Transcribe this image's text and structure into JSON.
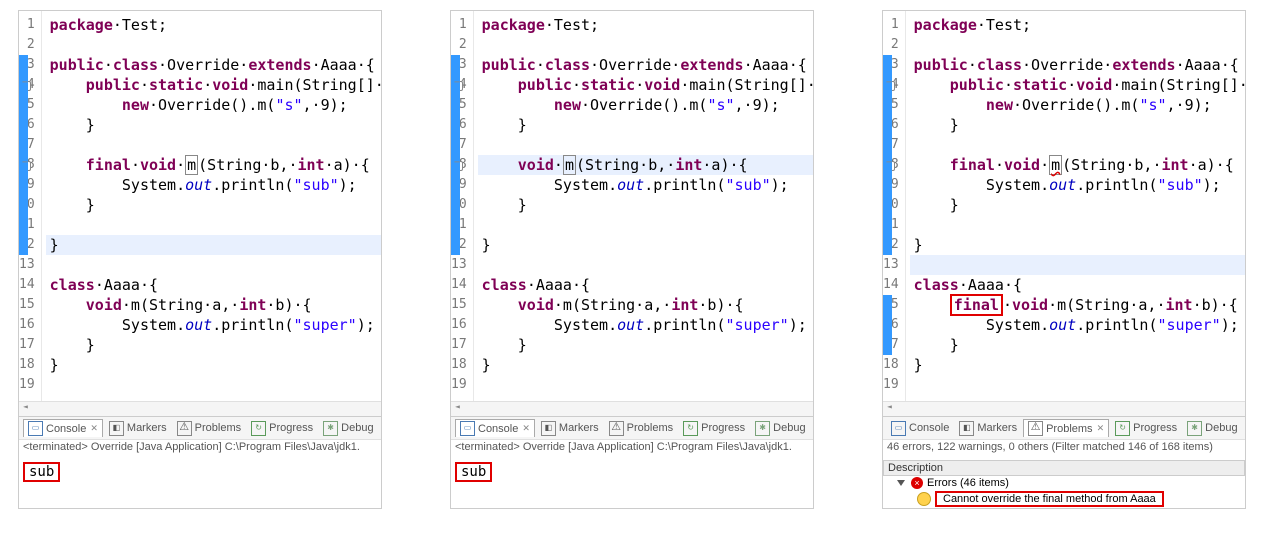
{
  "tabs": {
    "console": "Console",
    "markers": "Markers",
    "problems": "Problems",
    "progress": "Progress",
    "debug": "Debug"
  },
  "terminated": "<terminated> Override [Java Application] C:\\Program Files\\Java\\jdk1.",
  "console_out": "sub",
  "problems_summary": "46 errors, 122 warnings, 0 others (Filter matched 146 of 168 items)",
  "problems_header": "Description",
  "errors_group": "Errors (46 items)",
  "error_msg": "Cannot override the final method from Aaaa",
  "panes": [
    {
      "cursor": 12,
      "folds": [
        3,
        4,
        5,
        6,
        7,
        8,
        9,
        10,
        11,
        12
      ],
      "lines": [
        [
          {
            "t": "package",
            "c": "kw"
          },
          {
            "t": "·Test;"
          }
        ],
        [],
        [
          {
            "t": "public",
            "c": "kw"
          },
          {
            "t": "·"
          },
          {
            "t": "class",
            "c": "kw"
          },
          {
            "t": "·Override·"
          },
          {
            "t": "extends",
            "c": "kw"
          },
          {
            "t": "·Aaaa·{"
          }
        ],
        [
          {
            "t": "    "
          },
          {
            "t": "public",
            "c": "kw"
          },
          {
            "t": "·"
          },
          {
            "t": "static",
            "c": "kw"
          },
          {
            "t": "·"
          },
          {
            "t": "void",
            "c": "kw"
          },
          {
            "t": "·main(String[]·args)·{"
          }
        ],
        [
          {
            "t": "        "
          },
          {
            "t": "new",
            "c": "kw"
          },
          {
            "t": "·Override().m("
          },
          {
            "t": "\"s\"",
            "c": "str"
          },
          {
            "t": ",·9);"
          }
        ],
        [
          {
            "t": "    }"
          }
        ],
        [],
        [
          {
            "t": "    "
          },
          {
            "t": "final",
            "c": "kw"
          },
          {
            "t": "·"
          },
          {
            "t": "void",
            "c": "kw"
          },
          {
            "t": "·"
          },
          {
            "t": "m",
            "c": "box"
          },
          {
            "t": "(String·b,·"
          },
          {
            "t": "int",
            "c": "kw"
          },
          {
            "t": "·a)·{"
          }
        ],
        [
          {
            "t": "        System."
          },
          {
            "t": "out",
            "c": "fld"
          },
          {
            "t": ".println("
          },
          {
            "t": "\"sub\"",
            "c": "str"
          },
          {
            "t": ");"
          }
        ],
        [
          {
            "t": "    }"
          }
        ],
        [],
        [
          {
            "t": "}"
          }
        ],
        [],
        [
          {
            "t": "class",
            "c": "kw"
          },
          {
            "t": "·Aaaa·{"
          }
        ],
        [
          {
            "t": "    "
          },
          {
            "t": "void",
            "c": "kw"
          },
          {
            "t": "·m(String·a,·"
          },
          {
            "t": "int",
            "c": "kw"
          },
          {
            "t": "·b)·{"
          }
        ],
        [
          {
            "t": "        System."
          },
          {
            "t": "out",
            "c": "fld"
          },
          {
            "t": ".println("
          },
          {
            "t": "\"super\"",
            "c": "str"
          },
          {
            "t": ");"
          }
        ],
        [
          {
            "t": "    }"
          }
        ],
        [
          {
            "t": "}"
          }
        ],
        []
      ],
      "bottom": "console"
    },
    {
      "cursor": 8,
      "folds": [
        3,
        4,
        5,
        6,
        7,
        8,
        9,
        10,
        11,
        12
      ],
      "lines": [
        [
          {
            "t": "package",
            "c": "kw"
          },
          {
            "t": "·Test;"
          }
        ],
        [],
        [
          {
            "t": "public",
            "c": "kw"
          },
          {
            "t": "·"
          },
          {
            "t": "class",
            "c": "kw"
          },
          {
            "t": "·Override·"
          },
          {
            "t": "extends",
            "c": "kw"
          },
          {
            "t": "·Aaaa·{"
          }
        ],
        [
          {
            "t": "    "
          },
          {
            "t": "public",
            "c": "kw"
          },
          {
            "t": "·"
          },
          {
            "t": "static",
            "c": "kw"
          },
          {
            "t": "·"
          },
          {
            "t": "void",
            "c": "kw"
          },
          {
            "t": "·main(String[]·args)·{"
          }
        ],
        [
          {
            "t": "        "
          },
          {
            "t": "new",
            "c": "kw"
          },
          {
            "t": "·Override().m("
          },
          {
            "t": "\"s\"",
            "c": "str"
          },
          {
            "t": ",·9);"
          }
        ],
        [
          {
            "t": "    }"
          }
        ],
        [],
        [
          {
            "t": "    "
          },
          {
            "t": "void",
            "c": "kw"
          },
          {
            "t": "·"
          },
          {
            "t": "m",
            "c": "box"
          },
          {
            "t": "(String·b,·"
          },
          {
            "t": "int",
            "c": "kw"
          },
          {
            "t": "·a)·{"
          }
        ],
        [
          {
            "t": "        System."
          },
          {
            "t": "out",
            "c": "fld"
          },
          {
            "t": ".println("
          },
          {
            "t": "\"sub\"",
            "c": "str"
          },
          {
            "t": ");"
          }
        ],
        [
          {
            "t": "    }"
          }
        ],
        [],
        [
          {
            "t": "}"
          }
        ],
        [],
        [
          {
            "t": "class",
            "c": "kw"
          },
          {
            "t": "·Aaaa·{"
          }
        ],
        [
          {
            "t": "    "
          },
          {
            "t": "void",
            "c": "kw"
          },
          {
            "t": "·m(String·a,·"
          },
          {
            "t": "int",
            "c": "kw"
          },
          {
            "t": "·b)·{"
          }
        ],
        [
          {
            "t": "        System."
          },
          {
            "t": "out",
            "c": "fld"
          },
          {
            "t": ".println("
          },
          {
            "t": "\"super\"",
            "c": "str"
          },
          {
            "t": ");"
          }
        ],
        [
          {
            "t": "    }"
          }
        ],
        [
          {
            "t": "}"
          }
        ],
        []
      ],
      "bottom": "console"
    },
    {
      "cursor": 13,
      "folds": [
        3,
        4,
        5,
        6,
        7,
        8,
        9,
        10,
        11,
        12,
        15,
        16,
        17
      ],
      "errline": 8,
      "redbox_line": 15,
      "lines": [
        [
          {
            "t": "package",
            "c": "kw"
          },
          {
            "t": "·Test;"
          }
        ],
        [],
        [
          {
            "t": "public",
            "c": "kw"
          },
          {
            "t": "·"
          },
          {
            "t": "class",
            "c": "kw"
          },
          {
            "t": "·Override·"
          },
          {
            "t": "extends",
            "c": "kw"
          },
          {
            "t": "·Aaaa·{"
          }
        ],
        [
          {
            "t": "    "
          },
          {
            "t": "public",
            "c": "kw"
          },
          {
            "t": "·"
          },
          {
            "t": "static",
            "c": "kw"
          },
          {
            "t": "·"
          },
          {
            "t": "void",
            "c": "kw"
          },
          {
            "t": "·main(String[]·args)·{"
          }
        ],
        [
          {
            "t": "        "
          },
          {
            "t": "new",
            "c": "kw"
          },
          {
            "t": "·Override().m("
          },
          {
            "t": "\"s\"",
            "c": "str"
          },
          {
            "t": ",·9);"
          }
        ],
        [
          {
            "t": "    }"
          }
        ],
        [],
        [
          {
            "t": "    "
          },
          {
            "t": "final",
            "c": "kw"
          },
          {
            "t": "·"
          },
          {
            "t": "void",
            "c": "kw"
          },
          {
            "t": "·"
          },
          {
            "t": "m",
            "c": "box wavy"
          },
          {
            "t": "(String·b,·"
          },
          {
            "t": "int",
            "c": "kw"
          },
          {
            "t": "·a)·{"
          }
        ],
        [
          {
            "t": "        System."
          },
          {
            "t": "out",
            "c": "fld"
          },
          {
            "t": ".println("
          },
          {
            "t": "\"sub\"",
            "c": "str"
          },
          {
            "t": ");"
          }
        ],
        [
          {
            "t": "    }"
          }
        ],
        [],
        [
          {
            "t": "}"
          }
        ],
        [],
        [
          {
            "t": "class",
            "c": "kw"
          },
          {
            "t": "·Aaaa·{"
          }
        ],
        [
          {
            "t": "    "
          },
          {
            "t": "final",
            "c": "kw redbox-inline"
          },
          {
            "t": "·"
          },
          {
            "t": "void",
            "c": "kw"
          },
          {
            "t": "·m(String·a,·"
          },
          {
            "t": "int",
            "c": "kw"
          },
          {
            "t": "·b)·{"
          }
        ],
        [
          {
            "t": "        System."
          },
          {
            "t": "out",
            "c": "fld"
          },
          {
            "t": ".println("
          },
          {
            "t": "\"super\"",
            "c": "str"
          },
          {
            "t": ");"
          }
        ],
        [
          {
            "t": "    }"
          }
        ],
        [
          {
            "t": "}"
          }
        ],
        []
      ],
      "bottom": "problems"
    }
  ]
}
